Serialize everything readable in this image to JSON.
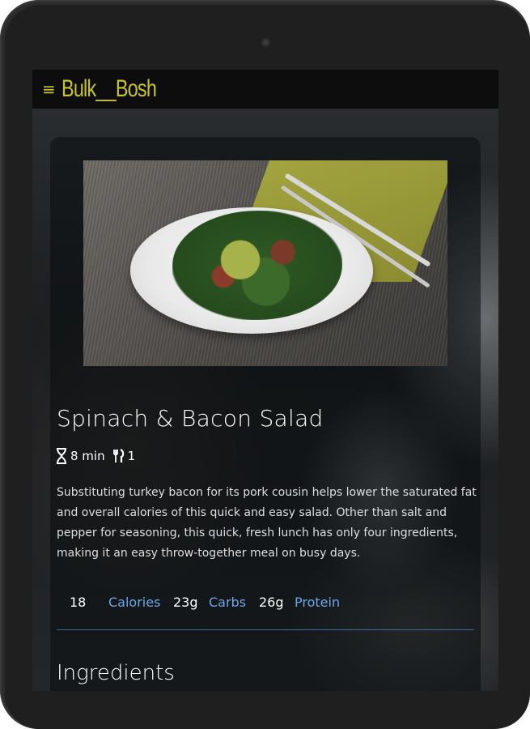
{
  "app": {
    "brand": "Bulk__Bosh",
    "menu_icon": "hamburger-menu-icon",
    "accent_color": "#c9c323"
  },
  "recipe": {
    "title": "Spinach & Bacon Salad",
    "time": "8 min",
    "servings": "1",
    "time_icon": "hourglass-icon",
    "servings_icon": "utensils-icon",
    "description": "Substituting turkey bacon for its pork cousin helps lower the saturated fat and overall calories of this quick and easy salad. Other than salt and pepper for seasoning, this quick, fresh lunch has only four ingredients, making it an easy throw-together meal on busy days.",
    "macros": {
      "calories_value": "18",
      "calories_label": "Calories",
      "carbs_value": "23g",
      "carbs_label": "Carbs",
      "protein_value": "26g",
      "protein_label": "Protein",
      "label_color": "#6aa6ea"
    },
    "ingredients_heading": "Ingredients"
  }
}
